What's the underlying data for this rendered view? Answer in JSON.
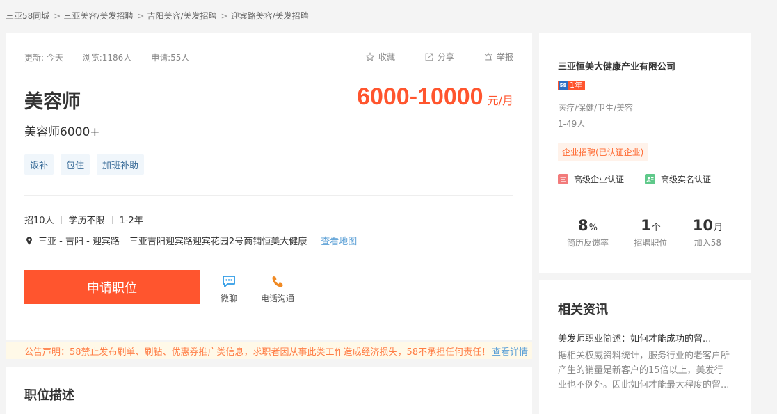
{
  "breadcrumb": {
    "items": [
      "三亚58同城",
      "三亚美容/美发招聘",
      "吉阳美容/美发招聘",
      "迎宾路美容/美发招聘"
    ],
    "separator": ">"
  },
  "job": {
    "update": "更新: 今天",
    "views": "浏览:1186人",
    "applies": "申请:55人",
    "actions": {
      "favorite": "收藏",
      "share": "分享",
      "report": "举报"
    },
    "title": "美容师",
    "salary": "6000-10000",
    "salary_unit": "元/月",
    "subtitle": "美容师6000+",
    "tags": [
      "饭补",
      "包住",
      "加班补助"
    ],
    "requirements": [
      "招10人",
      "学历不限",
      "1-2年"
    ],
    "location": "三亚 - 吉阳 - 迎宾路",
    "address": "三亚吉阳迎宾路迎宾花园2号商铺恒美大健康",
    "map_link": "查看地图",
    "apply_label": "申请职位",
    "chat_label": "微聊",
    "phone_label": "电话沟通"
  },
  "notice": {
    "text": "公告声明：58禁止发布刷单、刷钻、优惠券推广类信息，求职者因从事此类工作造成经济损失，58不承担任何责任！",
    "more": "查看详情"
  },
  "description": {
    "title": "职位描述"
  },
  "company": {
    "name": "三亚恒美大健康产业有限公司",
    "badge_logo": "58",
    "badge_year": "1年",
    "industry": "医疗/保健/卫生/美容",
    "size": "1-49人",
    "certification": "企业招聘(已认证企业)",
    "verifications": [
      "高级企业认证",
      "高级实名认证"
    ],
    "stats": [
      {
        "value": "8",
        "unit": "%",
        "label": "简历反馈率"
      },
      {
        "value": "1",
        "unit": "个",
        "label": "招聘职位"
      },
      {
        "value": "10",
        "unit": "月",
        "label": "加入58"
      }
    ]
  },
  "news": {
    "title": "相关资讯",
    "headline": "美发师职业简述：如何才能成功的留...",
    "body": "据相关权威资料统计，服务行业的老客户所产生的销量是新客户的15倍以上，美发行业也不例外。因此如何才能最大程度的留..."
  },
  "colors": {
    "accent": "#ff552e",
    "link": "#5a9fd6",
    "tag_bg": "#f0f6fb"
  }
}
